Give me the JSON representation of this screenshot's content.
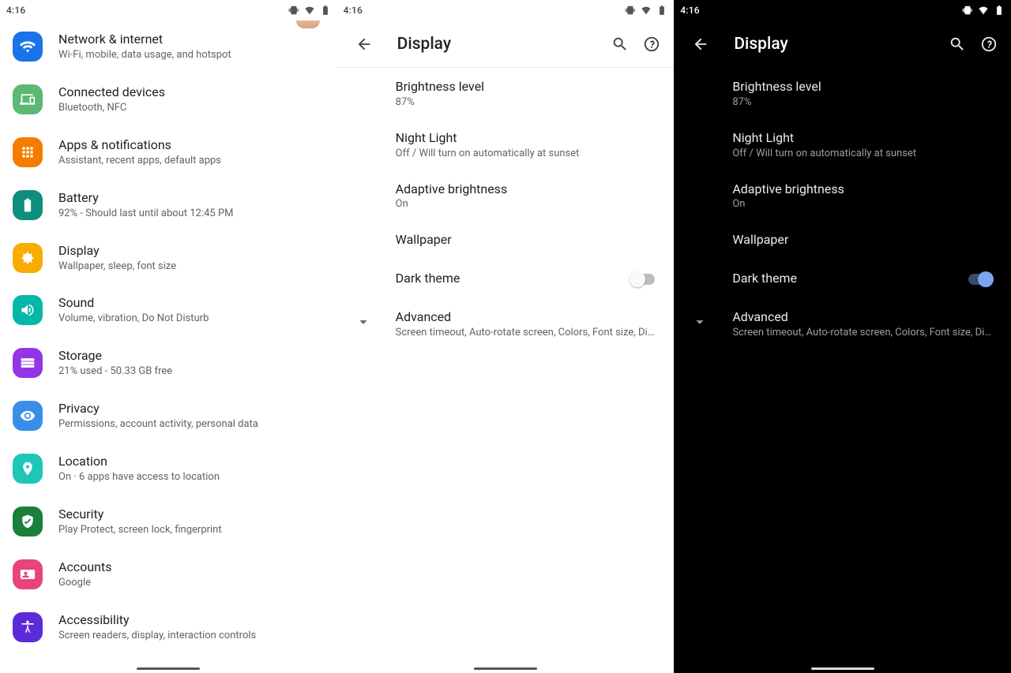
{
  "status": {
    "time": "4:16"
  },
  "panel1": {
    "items": [
      {
        "title": "Network & internet",
        "subtitle": "Wi-Fi, mobile, data usage, and hotspot",
        "bg": "#1a73e8",
        "icon": "wifi"
      },
      {
        "title": "Connected devices",
        "subtitle": "Bluetooth, NFC",
        "bg": "#5bb974",
        "icon": "devices"
      },
      {
        "title": "Apps & notifications",
        "subtitle": "Assistant, recent apps, default apps",
        "bg": "#f57c00",
        "icon": "apps"
      },
      {
        "title": "Battery",
        "subtitle": "92% - Should last until about 12:45 PM",
        "bg": "#0d8f7f",
        "icon": "battery"
      },
      {
        "title": "Display",
        "subtitle": "Wallpaper, sleep, font size",
        "bg": "#f9ab00",
        "icon": "brightness"
      },
      {
        "title": "Sound",
        "subtitle": "Volume, vibration, Do Not Disturb",
        "bg": "#04b8a8",
        "icon": "sound"
      },
      {
        "title": "Storage",
        "subtitle": "21% used - 50.33 GB free",
        "bg": "#9334e6",
        "icon": "storage"
      },
      {
        "title": "Privacy",
        "subtitle": "Permissions, account activity, personal data",
        "bg": "#3a8de8",
        "icon": "privacy"
      },
      {
        "title": "Location",
        "subtitle": "On · 6 apps have access to location",
        "bg": "#1ec6b6",
        "icon": "location"
      },
      {
        "title": "Security",
        "subtitle": "Play Protect, screen lock, fingerprint",
        "bg": "#188038",
        "icon": "security"
      },
      {
        "title": "Accounts",
        "subtitle": "Google",
        "bg": "#e8437a",
        "icon": "accounts"
      },
      {
        "title": "Accessibility",
        "subtitle": "Screen readers, display, interaction controls",
        "bg": "#5b2bd9",
        "icon": "accessibility"
      }
    ]
  },
  "display_page": {
    "title": "Display",
    "items": [
      {
        "key": "brightness",
        "title": "Brightness level",
        "subtitle": "87%"
      },
      {
        "key": "nightlight",
        "title": "Night Light",
        "subtitle": "Off / Will turn on automatically at sunset"
      },
      {
        "key": "adaptive",
        "title": "Adaptive brightness",
        "subtitle": "On"
      },
      {
        "key": "wallpaper",
        "title": "Wallpaper",
        "subtitle": ""
      },
      {
        "key": "darktheme",
        "title": "Dark theme",
        "subtitle": "",
        "switch": true
      },
      {
        "key": "advanced",
        "title": "Advanced",
        "subtitle": "Screen timeout, Auto-rotate screen, Colors, Font size, Display size",
        "chevron": true,
        "ellipsis": true
      }
    ]
  }
}
